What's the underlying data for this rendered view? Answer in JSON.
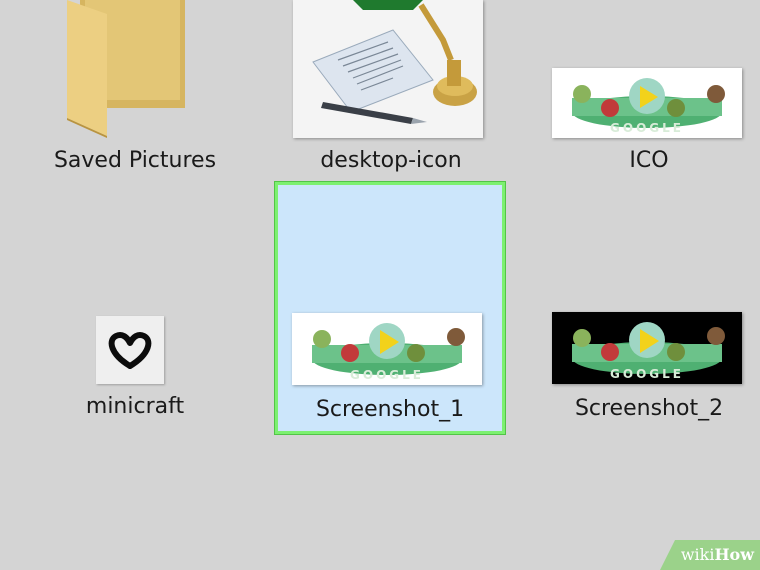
{
  "icons": [
    {
      "label": "Saved Pictures"
    },
    {
      "label": "desktop-icon"
    },
    {
      "label": "ICO"
    },
    {
      "label": "minicraft"
    },
    {
      "label": "Screenshot_1"
    },
    {
      "label": "Screenshot_2"
    }
  ],
  "doodle": {
    "logo_text": "GOOGLE"
  },
  "watermark": {
    "wiki": "wiki",
    "how": "How"
  }
}
